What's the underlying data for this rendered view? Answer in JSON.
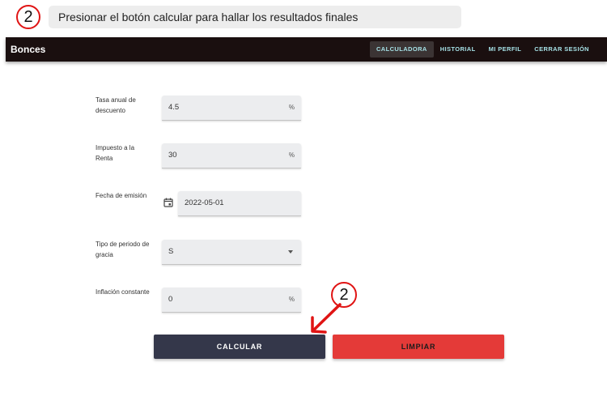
{
  "annotation": {
    "step_number": "2",
    "instruction": "Presionar el botón calcular para hallar los resultados finales",
    "arrow_step_number": "2",
    "color": "#e01414"
  },
  "appbar": {
    "brand": "Bonces",
    "nav": [
      {
        "label": "CALCULADORA",
        "active": true
      },
      {
        "label": "HISTORIAL",
        "active": false
      },
      {
        "label": "MI PERFIL",
        "active": false
      },
      {
        "label": "CERRAR SESIÓN",
        "active": false
      }
    ]
  },
  "form": {
    "tasa": {
      "label": "Tasa anual de descuento",
      "value": "4.5",
      "suffix": "%"
    },
    "impuesto": {
      "label": "Impuesto a la Renta",
      "value": "30",
      "suffix": "%"
    },
    "fecha": {
      "label": "Fecha de emisión",
      "value": "2022-05-01",
      "icon": "calendar-icon"
    },
    "periodo": {
      "label": "Tipo de periodo de gracia",
      "value": "S"
    },
    "inflacion": {
      "label": "Inflación constante",
      "value": "0",
      "suffix": "%"
    }
  },
  "buttons": {
    "calcular": "CALCULAR",
    "limpiar": "LIMPIAR"
  },
  "colors": {
    "appbar": "#1a0f0f",
    "nav_text": "#a6e1e6",
    "calc_button": "#34374a",
    "clear_button": "#e43a38",
    "field_bg": "#ecedef"
  }
}
